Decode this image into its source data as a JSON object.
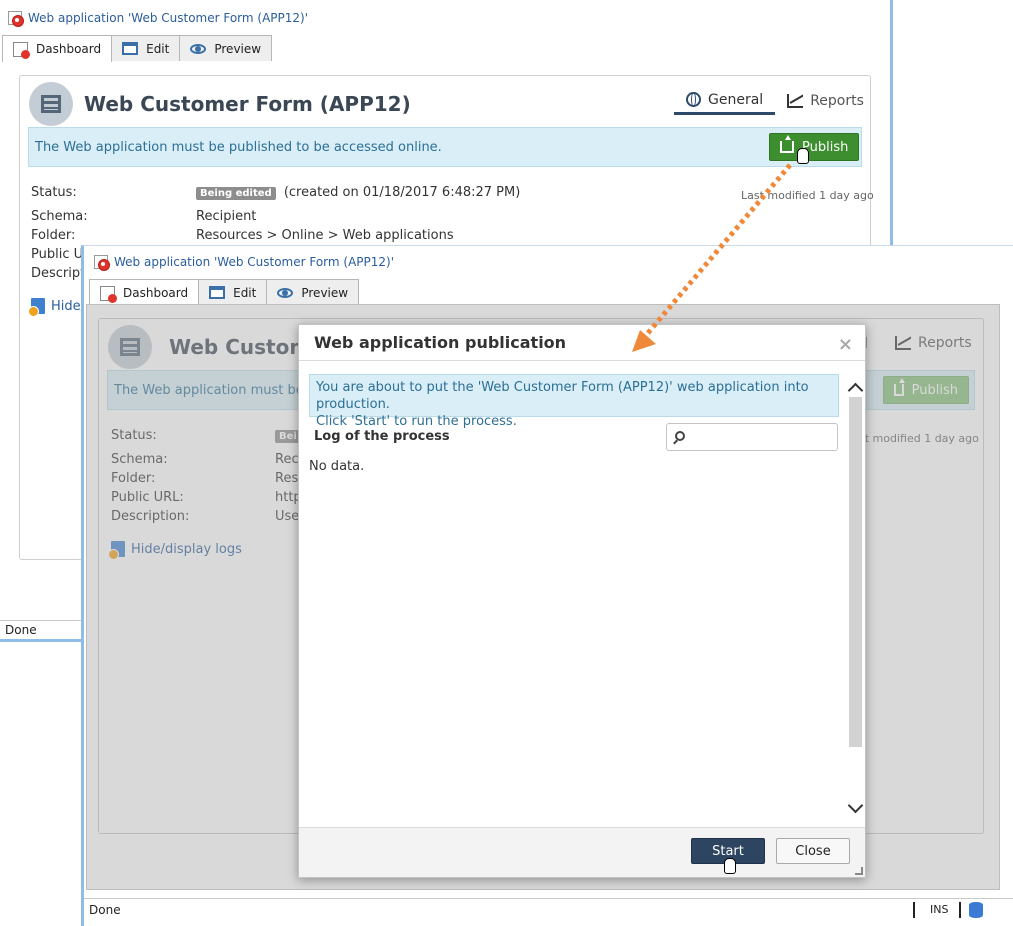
{
  "back_window": {
    "title": "Web application 'Web Customer Form (APP12)'",
    "tabs": [
      {
        "label": "Dashboard",
        "icon": "dashboard-icon"
      },
      {
        "label": "Edit",
        "icon": "edit-icon"
      },
      {
        "label": "Preview",
        "icon": "eye-icon"
      }
    ],
    "page_title": "Web Customer Form (APP12)",
    "view_tabs": [
      {
        "label": "General",
        "icon": "globe-icon"
      },
      {
        "label": "Reports",
        "icon": "chart-icon"
      }
    ],
    "notice": "The Web application must be published to be accessed online.",
    "publish_label": "Publish",
    "status_label": "Status:",
    "status_badge": "Being edited",
    "status_created": "(created on 01/18/2017 6:48:27 PM)",
    "last_modified": "Last modified 1 day ago",
    "schema_label": "Schema:",
    "schema_value": "Recipient",
    "folder_label": "Folder:",
    "folder_value": "Resources > Online > Web applications",
    "public_url_label": "Public U",
    "description_label": "Descripti",
    "logs_link": "Hide/",
    "status_bar": "Done"
  },
  "front_window": {
    "title": "Web application 'Web Customer Form (APP12)'",
    "tabs": [
      {
        "label": "Dashboard",
        "icon": "dashboard-icon"
      },
      {
        "label": "Edit",
        "icon": "edit-icon"
      },
      {
        "label": "Preview",
        "icon": "eye-icon"
      }
    ],
    "page_title": "Web Custom",
    "view_tab_partial": "l",
    "reports_label": "Reports",
    "notice": "The Web application must be p",
    "publish_label": "Publish",
    "status_label": "Status:",
    "status_badge": "Bei",
    "last_modified": "st modified 1 day ago",
    "schema_label": "Schema:",
    "schema_value": "Rec",
    "folder_label": "Folder:",
    "folder_value": "Res",
    "public_url_label": "Public URL:",
    "public_url_value": "http",
    "description_label": "Description:",
    "description_value": "Use",
    "logs_link": "Hide/display logs",
    "status_bar": "Done",
    "status_ins": "INS"
  },
  "dialog": {
    "title": "Web application publication",
    "close_glyph": "×",
    "notice_line1": "You are about to put the 'Web Customer Form (APP12)' web application into production.",
    "notice_line2": "Click 'Start' to run the process.",
    "log_label": "Log of the process",
    "search_placeholder": "",
    "no_data": "No data.",
    "start_label": "Start",
    "close_label": "Close"
  },
  "colors": {
    "accent_blue": "#2a5d9c",
    "publish_green": "#3d8e2f",
    "notice_bg": "#d9eef6",
    "arrow_orange": "#f0883a",
    "start_navy": "#2d4561"
  }
}
